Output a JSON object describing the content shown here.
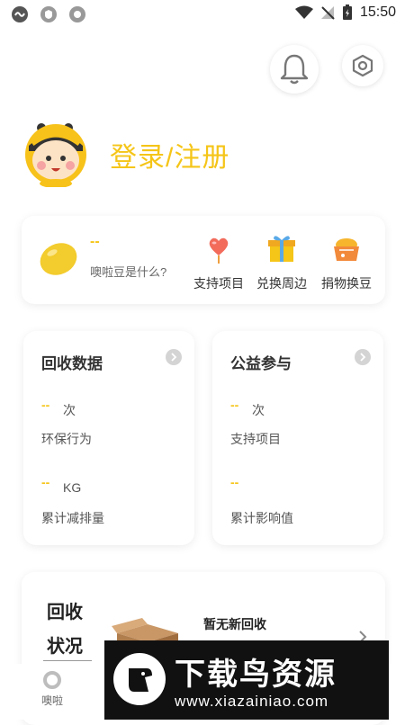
{
  "status_bar": {
    "time": "15:50"
  },
  "header": {
    "bell_icon": "bell-icon",
    "settings_icon": "hexagon-settings-icon"
  },
  "profile": {
    "login_label": "登录/注册"
  },
  "bean_card": {
    "value": "--",
    "question": "噢啦豆是什么?",
    "actions": [
      {
        "label": "支持项目",
        "icon": "heart-balloon-icon"
      },
      {
        "label": "兑换周边",
        "icon": "gift-box-icon"
      },
      {
        "label": "捐物换豆",
        "icon": "basket-icon"
      }
    ]
  },
  "recycle_data": {
    "title": "回收数据",
    "count_value": "--",
    "count_unit": "次",
    "count_label": "环保行为",
    "weight_value": "--",
    "weight_unit": "KG",
    "weight_label": "累计减排量"
  },
  "charity": {
    "title": "公益参与",
    "count_value": "--",
    "count_unit": "次",
    "count_label": "支持项目",
    "impact_value": "--",
    "impact_label": "累计影响值"
  },
  "recycle_status": {
    "title_line1": "回收",
    "title_line2": "状况",
    "empty_text": "暂无新回收"
  },
  "bottom_nav": {
    "home_label": "噢啦"
  },
  "watermark": {
    "text": "下载鸟资源",
    "url": "www.xiazainiao.com"
  },
  "colors": {
    "accent": "#f5c518"
  }
}
